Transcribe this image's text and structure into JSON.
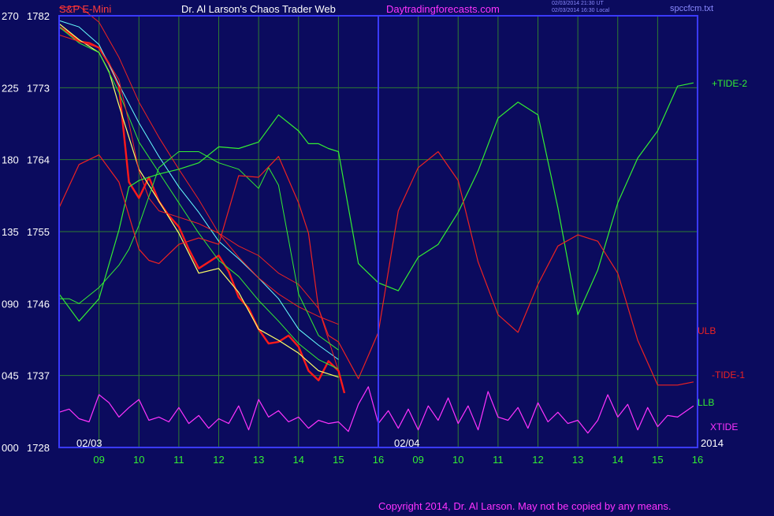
{
  "header": {
    "instrument": "S&P E-Mini",
    "title": "Dr. Al Larson's Chaos Trader Web",
    "site": "Daytradingforecasts.com",
    "timestamp_1": "02/03/2014 21:30 UT",
    "timestamp_2": "02/03/2014 16:30 Local",
    "file": "spccfcm.txt"
  },
  "footer": {
    "copyright": "Copyright 2014, Dr. Al Larson. May not be copied by any means."
  },
  "colors": {
    "background": "#0b0b5e",
    "grid": "#2e7d32",
    "frame": "#3a3aff",
    "price": "#ff1a1a",
    "ema_fast": "#ffff66",
    "ema_slow": "#66ffff",
    "tide_green": "#33ee33",
    "tide_red": "#ee2222",
    "xtide": "#ff33ff",
    "label_white": "#ffffff"
  },
  "chart_data": {
    "type": "line",
    "y_left_labels": [
      "270",
      "225",
      "180",
      "135",
      "090",
      "045",
      "000"
    ],
    "y_price_labels": [
      "1782",
      "1773",
      "1764",
      "1755",
      "1746",
      "1737",
      "1728"
    ],
    "x_hour_labels": [
      "09",
      "10",
      "11",
      "12",
      "13",
      "14",
      "15",
      "16",
      "09",
      "10",
      "11",
      "12",
      "13",
      "14",
      "15",
      "16"
    ],
    "date_labels": [
      "02/03",
      "02/04"
    ],
    "year_label": "2014",
    "right_labels": {
      "tide_plus2": "+TIDE-2",
      "ulb": "ULB",
      "tide_minus1": "-TIDE-1",
      "llb": "LLB",
      "xtide": "XTIDE"
    },
    "ylim_price": [
      1728,
      1782
    ],
    "ylim_index": [
      0,
      270
    ],
    "series": [
      {
        "name": "S&P E-Mini",
        "x": [
          0,
          0.25,
          0.5,
          0.75,
          1.0,
          1.25,
          1.5,
          1.75,
          2.0,
          2.25,
          2.5,
          2.75,
          3.0,
          3.25,
          3.5,
          3.75,
          4.0,
          4.25,
          4.5,
          4.75,
          5.0,
          5.25,
          5.5,
          5.75,
          6.0,
          6.25,
          6.5,
          6.75,
          7.0,
          7.15
        ],
        "y": [
          1780.6,
          1779.8,
          1778.8,
          1778.6,
          1778.0,
          1776.0,
          1773.2,
          1761.2,
          1759.2,
          1761.8,
          1758.8,
          1757.0,
          1755.6,
          1752.8,
          1750.4,
          1751.2,
          1752.0,
          1750.0,
          1746.8,
          1745.4,
          1742.8,
          1741.0,
          1741.2,
          1742.0,
          1740.6,
          1737.6,
          1736.4,
          1738.8,
          1737.6,
          1734.8
        ]
      },
      {
        "name": "",
        "x": [
          0,
          0.5,
          1.0,
          1.25,
          1.5,
          2.0,
          2.5,
          3.0,
          3.5,
          4.0,
          4.5,
          5.0,
          5.5,
          6.0,
          6.5,
          7.0
        ],
        "y": [
          1781.0,
          1779.0,
          1777.4,
          1775.0,
          1770.8,
          1762.8,
          1758.8,
          1754.8,
          1749.8,
          1750.4,
          1747.4,
          1742.8,
          1741.4,
          1739.8,
          1737.6,
          1736.8
        ]
      },
      {
        "name": "",
        "x": [
          0,
          0.5,
          1.0,
          1.5,
          2.0,
          2.5,
          3.0,
          3.5,
          4.0,
          4.5,
          5.0,
          5.5,
          6.0,
          6.5,
          7.0
        ],
        "y": [
          1780.6,
          1778.6,
          1777.4,
          1772.4,
          1766.2,
          1762.4,
          1758.6,
          1754.8,
          1751.4,
          1749.4,
          1746.4,
          1743.8,
          1741.0,
          1739.0,
          1737.8
        ]
      },
      {
        "name": "",
        "x": [
          0,
          0.5,
          1.0,
          1.5,
          2.0,
          2.5,
          3.0,
          3.5,
          4.0,
          4.5,
          5.0,
          5.5,
          6.0,
          6.5,
          7.0
        ],
        "y": [
          1781.4,
          1780.6,
          1778.4,
          1773.4,
          1768.6,
          1764.4,
          1760.6,
          1757.4,
          1753.8,
          1751.6,
          1749.2,
          1746.6,
          1742.8,
          1740.8,
          1739.0
        ]
      },
      {
        "name": "",
        "x": [
          0,
          0.5,
          1.0,
          1.5,
          1.75,
          2.0,
          2.25,
          2.5,
          3.0,
          3.5,
          4.0,
          4.5,
          5.0,
          5.5,
          6.0,
          6.5,
          7.0
        ],
        "y": [
          1779.6,
          1778.8,
          1778.0,
          1774.0,
          1768.6,
          1762.6,
          1759.2,
          1757.6,
          1756.8,
          1756.0,
          1754.8,
          1753.2,
          1752.0,
          1749.8,
          1748.4,
          1745.4,
          1737.6
        ]
      },
      {
        "name": "",
        "x": [
          0,
          0.5,
          1.0,
          1.5,
          2.0,
          2.5,
          3.0,
          3.5,
          4.0,
          4.5,
          5.0,
          5.5,
          6.0,
          6.5,
          7.0
        ],
        "y": [
          1783.0,
          1783.2,
          1781.2,
          1776.8,
          1771.2,
          1766.8,
          1762.8,
          1759.0,
          1754.8,
          1751.8,
          1749.2,
          1747.2,
          1745.6,
          1744.4,
          1743.4
        ]
      },
      {
        "name": "",
        "x": [
          0,
          0.25,
          0.5,
          1.0,
          1.5,
          1.75,
          2.0,
          2.5,
          3.0,
          3.5,
          4.0,
          4.5,
          5.0,
          5.25,
          5.5,
          6.0,
          6.5,
          7.0
        ],
        "y": [
          1746.6,
          1746.6,
          1746.0,
          1748.0,
          1750.8,
          1752.8,
          1755.8,
          1763.0,
          1765.0,
          1765.0,
          1763.6,
          1762.8,
          1760.4,
          1763.0,
          1760.8,
          1747.2,
          1742.0,
          1740.2
        ]
      },
      {
        "name": "",
        "x": [
          0,
          0.5,
          1.0,
          1.5,
          1.75,
          2.0,
          2.5,
          3.0,
          3.5,
          4.0,
          4.5,
          5.0,
          5.5,
          6.0,
          6.25,
          6.5,
          6.75,
          7.0,
          7.5,
          8.0,
          8.5,
          9.0,
          9.5,
          10.0,
          10.5,
          11.0,
          11.5,
          12.0,
          12.5,
          13.0,
          13.5,
          14.0,
          14.5,
          15.0,
          15.5,
          15.9
        ],
        "y": [
          1747.2,
          1743.8,
          1746.6,
          1755.2,
          1760.6,
          1761.4,
          1762.2,
          1762.8,
          1763.6,
          1765.6,
          1765.4,
          1766.2,
          1769.6,
          1767.6,
          1766.0,
          1766.0,
          1765.4,
          1765.0,
          1751.0,
          1748.6,
          1747.6,
          1751.8,
          1753.4,
          1757.4,
          1762.6,
          1769.2,
          1771.2,
          1769.6,
          1758.0,
          1744.6,
          1750.2,
          1758.6,
          1764.2,
          1767.6,
          1773.2,
          1773.6
        ]
      },
      {
        "name": "",
        "x": [
          0,
          0.5,
          1.0,
          1.5,
          2.0,
          2.25,
          2.5,
          3.0,
          3.5,
          4.0,
          4.5,
          5.0,
          5.5,
          6.0,
          6.25,
          6.5,
          6.75,
          7.0,
          7.5,
          8.0,
          8.5,
          9.0,
          9.5,
          10.0,
          10.5,
          11.0,
          11.5,
          12.0,
          12.5,
          13.0,
          13.5,
          14.0,
          14.5,
          15.0,
          15.5,
          15.9
        ],
        "y": [
          1758.0,
          1763.4,
          1764.6,
          1761.2,
          1752.8,
          1751.4,
          1751.0,
          1753.4,
          1754.2,
          1753.4,
          1762.0,
          1761.8,
          1764.4,
          1758.6,
          1754.8,
          1745.4,
          1742.0,
          1741.2,
          1736.6,
          1742.4,
          1757.6,
          1763.0,
          1765.0,
          1761.4,
          1751.2,
          1744.6,
          1742.4,
          1748.4,
          1753.2,
          1754.6,
          1753.8,
          1749.8,
          1741.4,
          1735.8,
          1735.8,
          1736.2
        ]
      },
      {
        "name": "",
        "x": [
          0,
          0.25,
          0.5,
          0.75,
          1.0,
          1.25,
          1.5,
          1.75,
          2.0,
          2.25,
          2.5,
          2.75,
          3.0,
          3.25,
          3.5,
          3.75,
          4.0,
          4.25,
          4.5,
          4.75,
          5.0,
          5.25,
          5.5,
          5.75,
          6.0,
          6.25,
          6.5,
          6.75,
          7.0,
          7.25,
          7.5,
          7.75,
          8.0,
          8.25,
          8.5,
          8.75,
          9.0,
          9.25,
          9.5,
          9.75,
          10.0,
          10.25,
          10.5,
          10.75,
          11.0,
          11.25,
          11.5,
          11.75,
          12.0,
          12.25,
          12.5,
          12.75,
          13.0,
          13.25,
          13.5,
          13.75,
          14.0,
          14.25,
          14.5,
          14.75,
          15.0,
          15.25,
          15.5,
          15.9
        ],
        "y": [
          1732.4,
          1732.8,
          1731.6,
          1731.2,
          1734.6,
          1733.6,
          1731.8,
          1733.0,
          1734.0,
          1731.4,
          1731.8,
          1731.2,
          1733.0,
          1731.0,
          1732.0,
          1730.4,
          1731.6,
          1731.0,
          1733.2,
          1730.2,
          1734.0,
          1731.8,
          1732.6,
          1731.2,
          1731.8,
          1730.4,
          1731.4,
          1731.0,
          1731.2,
          1730.0,
          1733.4,
          1735.6,
          1731.0,
          1732.6,
          1730.4,
          1732.8,
          1730.2,
          1733.2,
          1731.4,
          1734.2,
          1731.0,
          1733.2,
          1730.2,
          1735.0,
          1731.8,
          1731.4,
          1733.0,
          1730.4,
          1733.6,
          1731.2,
          1732.4,
          1731.0,
          1731.4,
          1729.8,
          1731.4,
          1734.6,
          1731.8,
          1733.4,
          1730.2,
          1733.0,
          1730.6,
          1732.0,
          1731.8,
          1733.2
        ]
      }
    ]
  }
}
